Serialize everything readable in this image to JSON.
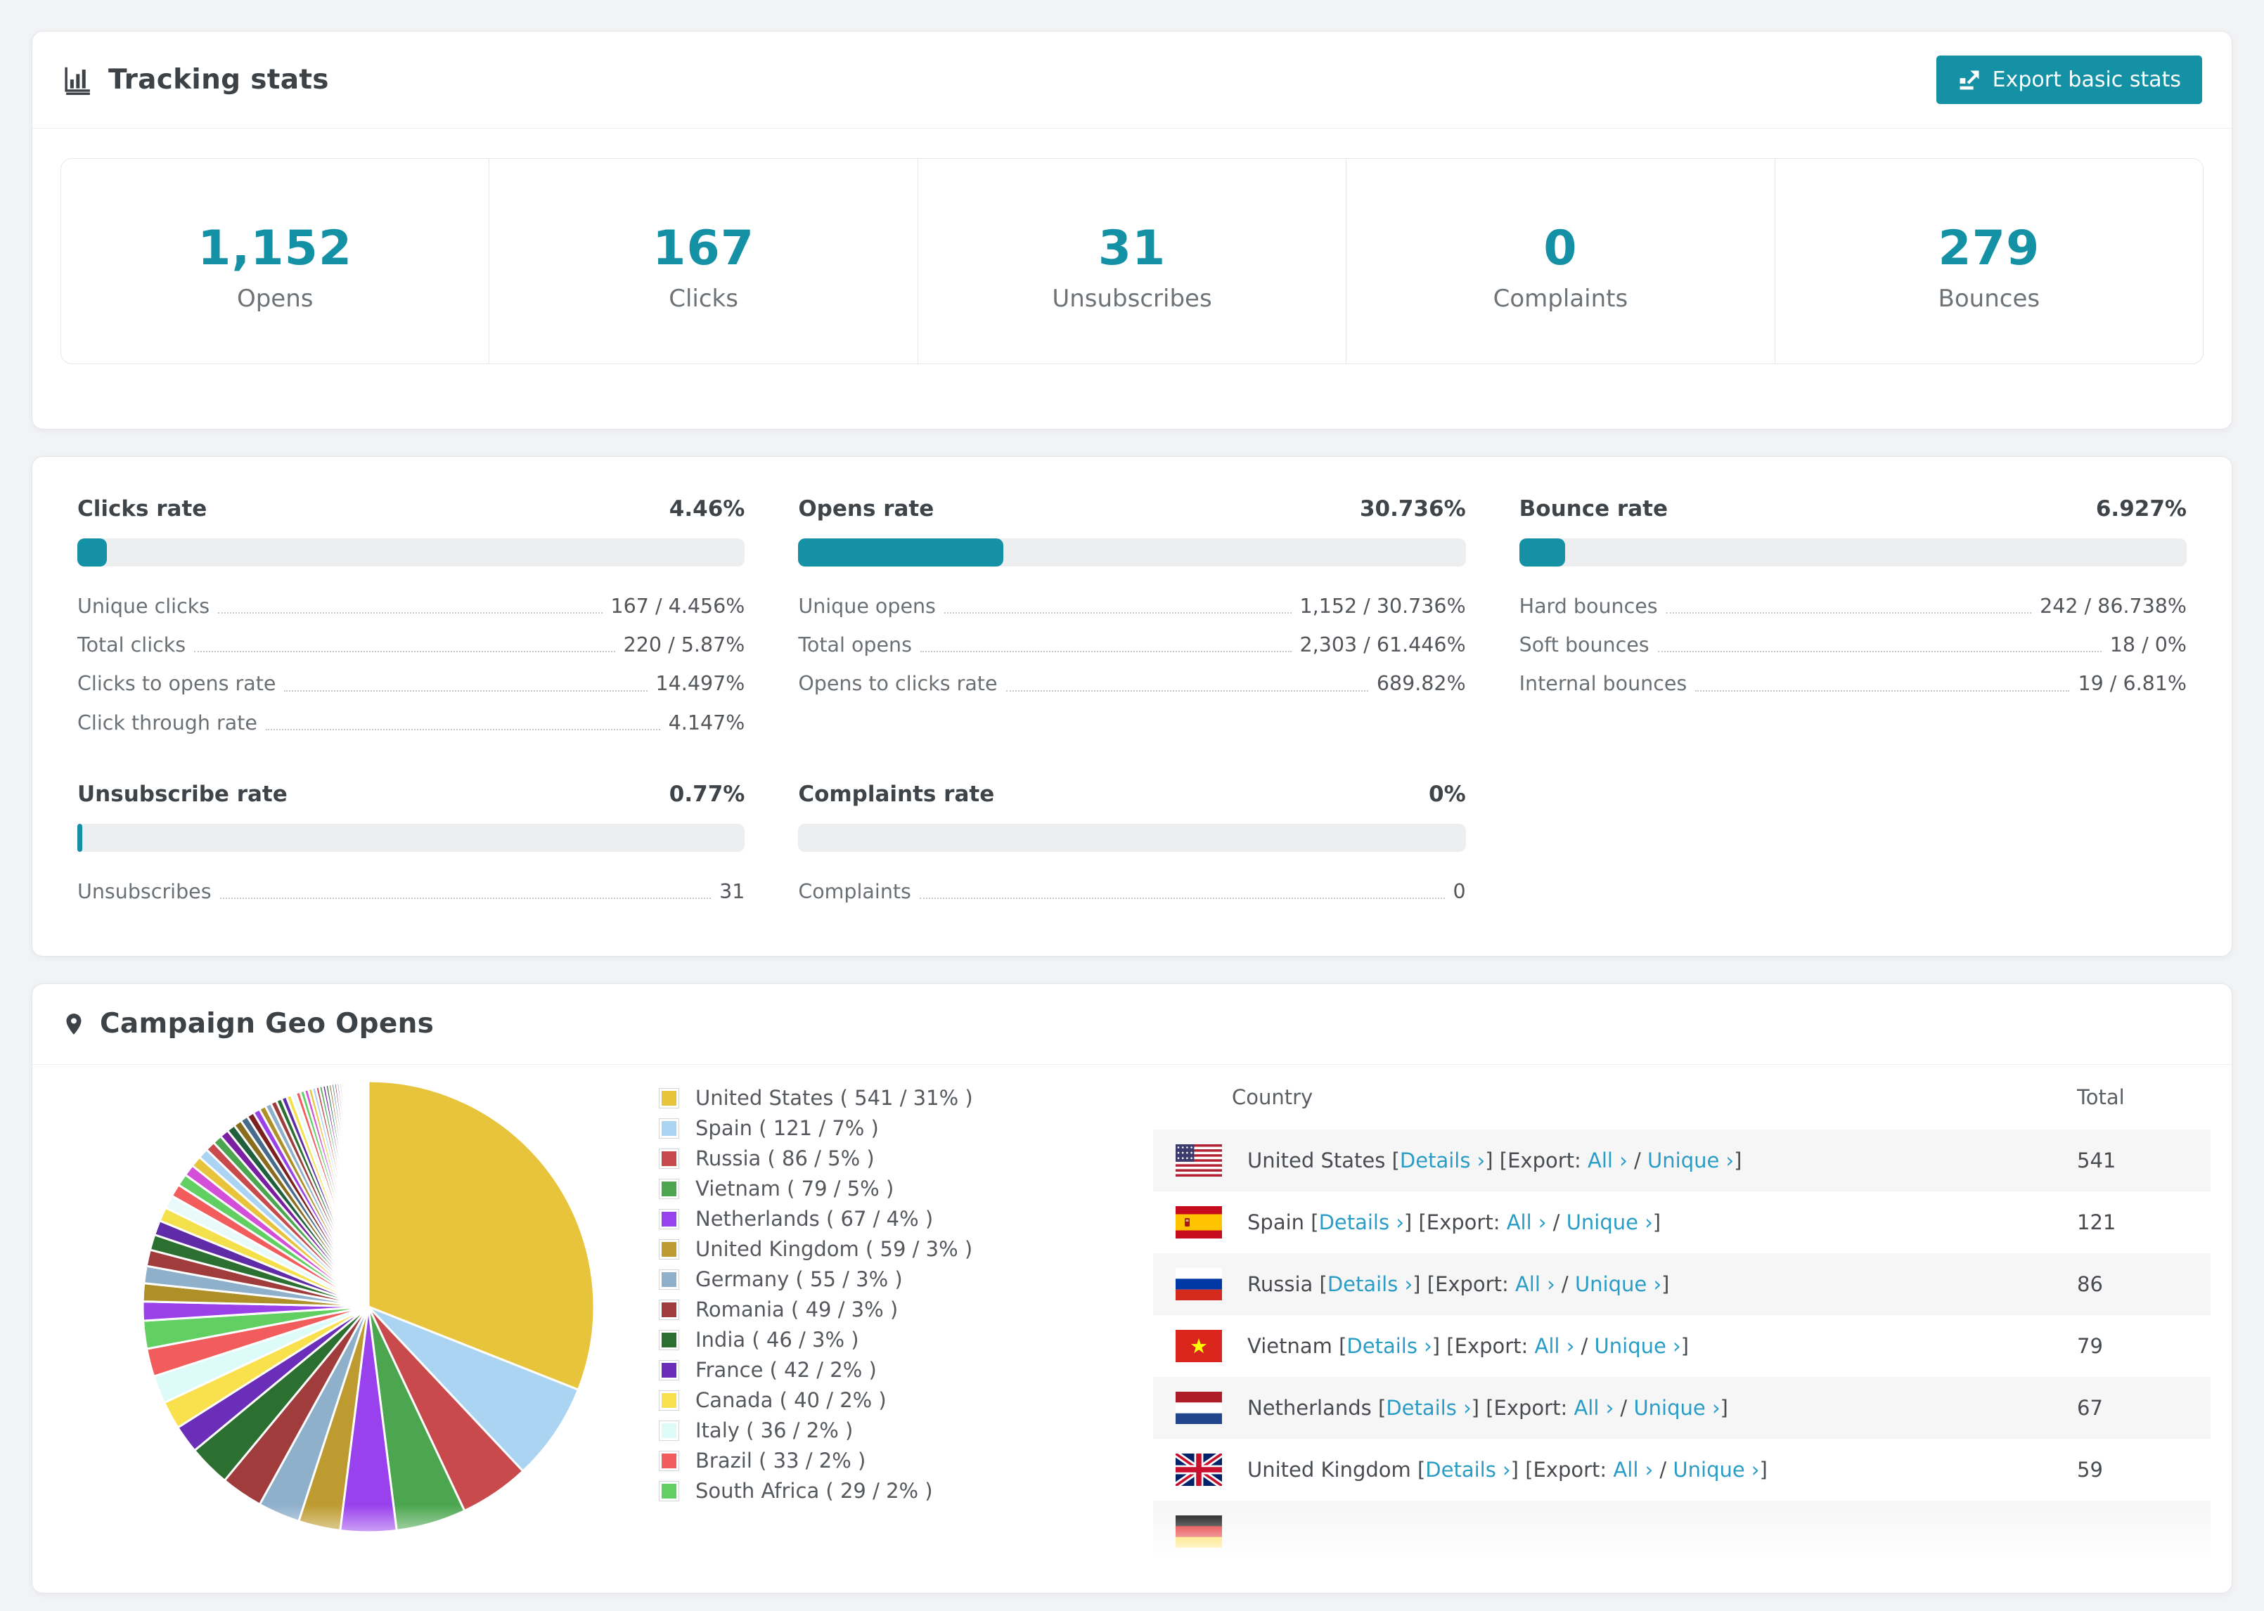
{
  "colors": {
    "accent": "#1591a6",
    "link": "#2a9dc6",
    "bar_track": "#eceef0"
  },
  "icons": {
    "header": "bar-chart-icon",
    "export": "export-icon",
    "geo": "map-pin-icon"
  },
  "tracking": {
    "title": "Tracking stats",
    "export_label": "Export basic stats"
  },
  "stats": {
    "boxes": [
      {
        "value": "1,152",
        "label": "Opens"
      },
      {
        "value": "167",
        "label": "Clicks"
      },
      {
        "value": "31",
        "label": "Unsubscribes"
      },
      {
        "value": "0",
        "label": "Complaints"
      },
      {
        "value": "279",
        "label": "Bounces"
      }
    ]
  },
  "rates": {
    "blocks": [
      {
        "title": "Clicks rate",
        "value": "4.46%",
        "pct": 4.46,
        "rows": [
          {
            "label": "Unique clicks",
            "value": "167 / 4.456%"
          },
          {
            "label": "Total clicks",
            "value": "220 / 5.87%"
          },
          {
            "label": "Clicks to opens rate",
            "value": "14.497%"
          },
          {
            "label": "Click through rate",
            "value": "4.147%"
          }
        ]
      },
      {
        "title": "Opens rate",
        "value": "30.736%",
        "pct": 30.736,
        "rows": [
          {
            "label": "Unique opens",
            "value": "1,152 / 30.736%"
          },
          {
            "label": "Total opens",
            "value": "2,303 / 61.446%"
          },
          {
            "label": "Opens to clicks rate",
            "value": "689.82%"
          }
        ]
      },
      {
        "title": "Bounce rate",
        "value": "6.927%",
        "pct": 6.927,
        "rows": [
          {
            "label": "Hard bounces",
            "value": "242 / 86.738%"
          },
          {
            "label": "Soft bounces",
            "value": "18 / 0%"
          },
          {
            "label": "Internal bounces",
            "value": "19 / 6.81%"
          }
        ]
      },
      {
        "title": "Unsubscribe rate",
        "value": "0.77%",
        "pct": 0.77,
        "rows": [
          {
            "label": "Unsubscribes",
            "value": "31"
          }
        ]
      },
      {
        "title": "Complaints rate",
        "value": "0%",
        "pct": 0,
        "rows": [
          {
            "label": "Complaints",
            "value": "0"
          }
        ]
      }
    ]
  },
  "geo": {
    "title": "Campaign Geo Opens",
    "legend": [
      {
        "label": "United States ( 541 / 31% )",
        "color": "#e8c33c"
      },
      {
        "label": "Spain ( 121 / 7% )",
        "color": "#abd3f2"
      },
      {
        "label": "Russia ( 86 / 5% )",
        "color": "#c94a4c"
      },
      {
        "label": "Vietnam ( 79 / 5% )",
        "color": "#4ba64f"
      },
      {
        "label": "Netherlands ( 67 / 4% )",
        "color": "#9941ec"
      },
      {
        "label": "United Kingdom ( 59 / 3% )",
        "color": "#bd9b30"
      },
      {
        "label": "Germany ( 55 / 3% )",
        "color": "#8fb0cb"
      },
      {
        "label": "Romania ( 49 / 3% )",
        "color": "#a03c3c"
      },
      {
        "label": "India ( 46 / 3% )",
        "color": "#2c7031"
      },
      {
        "label": "France ( 42 / 2% )",
        "color": "#6a2eb8"
      },
      {
        "label": "Canada ( 40 / 2% )",
        "color": "#f9e04d"
      },
      {
        "label": "Italy ( 36 / 2% )",
        "color": "#dcfbf9"
      },
      {
        "label": "Brazil ( 33 / 2% )",
        "color": "#f25c5c"
      },
      {
        "label": "South Africa ( 29 / 2% )",
        "color": "#62cf63"
      }
    ],
    "table": {
      "header_country": "Country",
      "header_total": "Total",
      "links": {
        "details": "Details ›",
        "export_label": "Export:",
        "all": "All ›",
        "unique": "Unique ›"
      },
      "rows": [
        {
          "country": "United States",
          "flag": "us",
          "total": "541"
        },
        {
          "country": "Spain",
          "flag": "es",
          "total": "121"
        },
        {
          "country": "Russia",
          "flag": "ru",
          "total": "86"
        },
        {
          "country": "Vietnam",
          "flag": "vn",
          "total": "79"
        },
        {
          "country": "Netherlands",
          "flag": "nl",
          "total": "67"
        },
        {
          "country": "United Kingdom",
          "flag": "gb",
          "total": "59"
        },
        {
          "country": "",
          "flag": "de",
          "total": ""
        }
      ]
    }
  },
  "chart_data": {
    "type": "pie",
    "title": "Campaign Geo Opens",
    "unit": "opens",
    "start": "top",
    "direction": "clockwise",
    "legend_position": "right",
    "labels": [
      "United States",
      "Spain",
      "Russia",
      "Vietnam",
      "Netherlands",
      "United Kingdom",
      "Germany",
      "Romania",
      "India",
      "France",
      "Canada",
      "Italy",
      "Brazil",
      "South Africa"
    ],
    "values": [
      541,
      121,
      86,
      79,
      67,
      59,
      55,
      49,
      46,
      42,
      40,
      36,
      33,
      29
    ],
    "pcts": [
      31,
      7,
      5,
      5,
      4,
      3,
      3,
      3,
      3,
      2,
      2,
      2,
      2,
      2
    ],
    "colors": [
      "#e8c33c",
      "#abd3f2",
      "#c94a4c",
      "#4ba64f",
      "#9941ec",
      "#bd9b30",
      "#8fb0cb",
      "#a03c3c",
      "#2c7031",
      "#6a2eb8",
      "#f9e04d",
      "#dcfbf9",
      "#f25c5c",
      "#62cf63"
    ],
    "others_pct": 26,
    "others_slice_count": 60,
    "others_decay": 0.95,
    "other_slice_colors": [
      "#9a41ea",
      "#ae8f28",
      "#8fb0cb",
      "#a03c3c",
      "#2c7031",
      "#5f2ba6",
      "#f4e04b",
      "#e8fbfa",
      "#f25c5c",
      "#62cf63",
      "#d44fd8",
      "#e8c33c",
      "#abd3f2",
      "#c94a4c",
      "#4ba64f",
      "#7a1fa2",
      "#20603f",
      "#8a6d1c",
      "#476b8a",
      "#7d2020"
    ]
  }
}
